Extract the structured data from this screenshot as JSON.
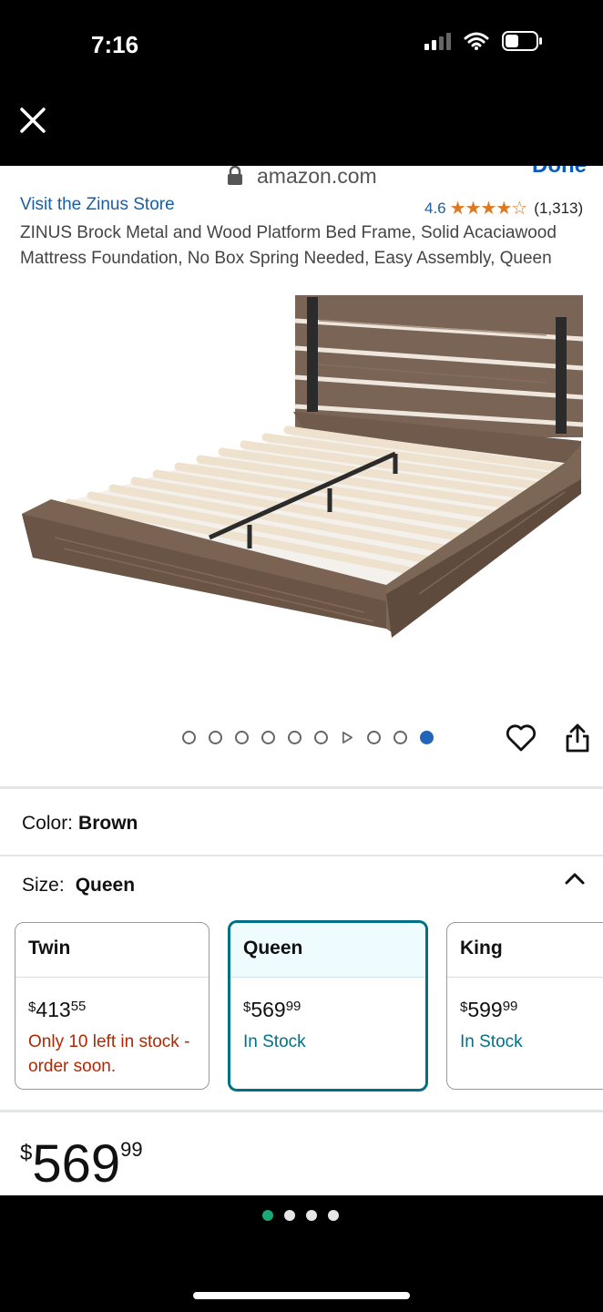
{
  "status": {
    "time": "7:16"
  },
  "browser": {
    "domain": "amazon.com",
    "done_label": "Done"
  },
  "product": {
    "store_link": "Visit the Zinus Store",
    "rating_value": "4.6",
    "rating_stars": "★★★★☆",
    "rating_count": "(1,313)",
    "title": "ZINUS Brock Metal and Wood Platform Bed Frame, Solid Acaciawood Mattress Foundation, No Box Spring Needed, Easy Assembly, Queen",
    "image_count": 10,
    "active_image_index": 9
  },
  "color": {
    "label": "Color:",
    "value": "Brown"
  },
  "size": {
    "label": "Size:",
    "value": "Queen",
    "options": [
      {
        "name": "Twin",
        "currency": "$",
        "whole": "413",
        "cents": "55",
        "stock": "Only 10 left in stock - order soon.",
        "stock_type": "low"
      },
      {
        "name": "Queen",
        "currency": "$",
        "whole": "569",
        "cents": "99",
        "stock": "In Stock",
        "stock_type": "ok",
        "selected": true
      },
      {
        "name": "King",
        "currency": "$",
        "whole": "599",
        "cents": "99",
        "stock": "In Stock",
        "stock_type": "ok"
      }
    ]
  },
  "price": {
    "currency": "$",
    "whole": "569",
    "cents": "99"
  },
  "colors": {
    "link": "#1b5fa1",
    "star": "#de7921",
    "in_stock": "#007185",
    "low_stock": "#b12704",
    "active_dot": "#2165b8"
  }
}
